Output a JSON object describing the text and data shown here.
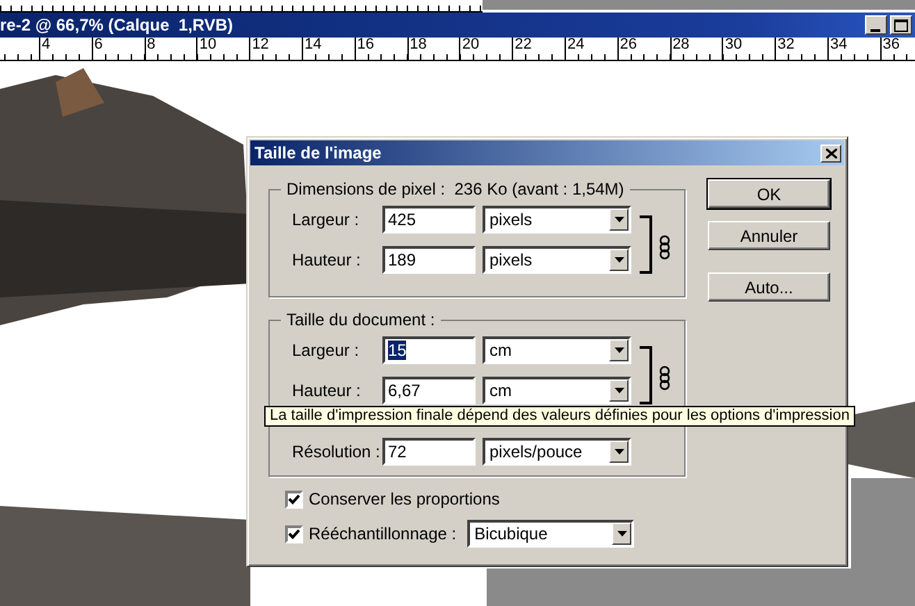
{
  "document_window": {
    "title": "re-2 @ 66,7% (Calque  1,RVB)",
    "ruler_labels": [
      "4",
      "6",
      "8",
      "10",
      "12",
      "14",
      "16",
      "18",
      "20",
      "22",
      "24",
      "26",
      "28",
      "30",
      "32",
      "34",
      "36"
    ]
  },
  "dialog": {
    "title": "Taille de l'image",
    "pixel_dimensions": {
      "legend": "Dimensions de pixel :  236 Ko (avant : 1,54M)",
      "linked": true,
      "rows": [
        {
          "label": "Largeur :",
          "value": "425",
          "unit": "pixels",
          "highlighted": false
        },
        {
          "label": "Hauteur :",
          "value": "189",
          "unit": "pixels",
          "highlighted": false
        }
      ]
    },
    "document_size": {
      "legend": "Taille du document :",
      "linked": true,
      "rows": [
        {
          "label": "Largeur :",
          "value": "15",
          "unit": "cm",
          "highlighted": true
        },
        {
          "label": "Hauteur :",
          "value": "6,67",
          "unit": "cm",
          "highlighted": false
        },
        {
          "label": "Résolution :",
          "value": "72",
          "unit": "pixels/pouce",
          "highlighted": false
        }
      ]
    },
    "options": [
      {
        "kind": "checkbox",
        "label": "Conserver les proportions",
        "checked": true
      },
      {
        "kind": "checkbox-dropdown",
        "label": "Rééchantillonnage :",
        "checked": true,
        "value": "Bicubique"
      }
    ],
    "buttons": [
      "OK",
      "Annuler",
      "Auto..."
    ],
    "tooltip": "La taille d'impression finale dépend des valeurs définies pour les options d'impression"
  }
}
